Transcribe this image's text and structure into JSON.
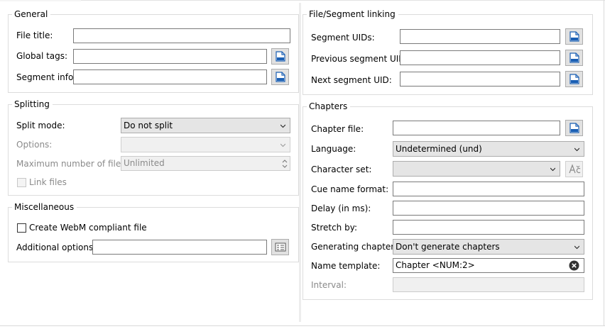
{
  "general": {
    "legend": "General",
    "file_title_label": "File title:",
    "file_title_value": "",
    "global_tags_label": "Global tags:",
    "global_tags_value": "",
    "segment_info_label": "Segment info:",
    "segment_info_value": ""
  },
  "splitting": {
    "legend": "Splitting",
    "split_mode_label": "Split mode:",
    "split_mode_value": "Do not split",
    "options_label": "Options:",
    "options_value": "",
    "max_files_label": "Maximum number of files:",
    "max_files_value": "Unlimited",
    "link_files_label": "Link files"
  },
  "misc": {
    "legend": "Miscellaneous",
    "webm_label": "Create WebM compliant file",
    "additional_label": "Additional options:",
    "additional_value": ""
  },
  "linking": {
    "legend": "File/Segment linking",
    "segment_uids_label": "Segment UIDs:",
    "segment_uids_value": "",
    "prev_uid_label": "Previous segment UID:",
    "prev_uid_value": "",
    "next_uid_label": "Next segment UID:",
    "next_uid_value": ""
  },
  "chapters": {
    "legend": "Chapters",
    "chapter_file_label": "Chapter file:",
    "chapter_file_value": "",
    "language_label": "Language:",
    "language_value": "Undetermined (und)",
    "charset_label": "Character set:",
    "charset_value": "",
    "cue_format_label": "Cue name format:",
    "cue_format_value": "",
    "delay_label": "Delay (in ms):",
    "delay_value": "",
    "stretch_label": "Stretch by:",
    "stretch_value": "",
    "generating_label": "Generating chapters:",
    "generating_value": "Don't generate chapters",
    "name_template_label": "Name template:",
    "name_template_value": "Chapter <NUM:2>",
    "interval_label": "Interval:",
    "interval_value": ""
  },
  "icons": {
    "browse": "browse-file-icon",
    "clear": "clear-icon",
    "charset": "charset-icon",
    "options_editor": "options-editor-icon"
  },
  "colors": {
    "icon_blue": "#1a5fb4",
    "group_border": "#dcdcdc",
    "disabled_text": "#8a8a8a"
  }
}
